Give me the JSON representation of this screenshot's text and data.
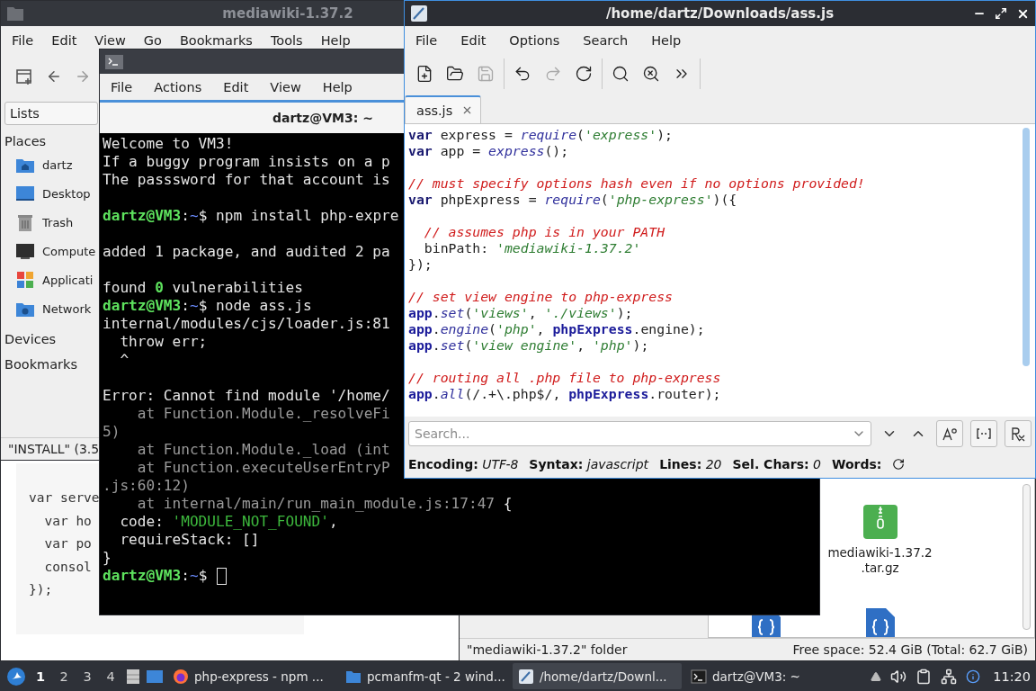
{
  "file_manager": {
    "title": "mediawiki-1.37.2",
    "menu": [
      "File",
      "Edit",
      "View",
      "Go",
      "Bookmarks",
      "Tools",
      "Help"
    ],
    "sidebar_mode": "Lists",
    "sections": [
      {
        "label": "Places",
        "items": [
          {
            "label": "dartz",
            "kind": "home"
          },
          {
            "label": "Desktop",
            "kind": "desktop"
          },
          {
            "label": "Trash",
            "kind": "trash"
          },
          {
            "label": "Compute",
            "kind": "computer"
          },
          {
            "label": "Applicati",
            "kind": "apps"
          },
          {
            "label": "Network",
            "kind": "network"
          }
        ]
      },
      {
        "label": "Devices"
      },
      {
        "label": "Bookmarks"
      }
    ],
    "status": "\"INSTALL\" (3.5"
  },
  "browser_page": {
    "code_lines": [
      "var serve",
      "  var ho",
      "  var po",
      "  consol",
      "});"
    ]
  },
  "terminal": {
    "menu": [
      "File",
      "Actions",
      "Edit",
      "View",
      "Help"
    ],
    "tab": "dartz@VM3: ~",
    "lines": [
      {
        "parts": [
          {
            "kind": "plain",
            "text": "Welcome to VM3!"
          }
        ]
      },
      {
        "parts": [
          {
            "kind": "plain",
            "text": "If a buggy program insists on a p"
          }
        ]
      },
      {
        "parts": [
          {
            "kind": "plain",
            "text": "The passsword for that account is"
          }
        ]
      },
      {
        "kind": "blank"
      },
      {
        "parts": [
          {
            "kind": "user",
            "text": "dartz@VM3"
          },
          {
            "kind": "plain",
            "text": ":"
          },
          {
            "kind": "path",
            "text": "~"
          },
          {
            "kind": "plain",
            "text": "$ npm install php-expre"
          }
        ]
      },
      {
        "kind": "blank"
      },
      {
        "parts": [
          {
            "kind": "plain",
            "text": "added 1 package, and audited 2 pa"
          }
        ]
      },
      {
        "kind": "blank"
      },
      {
        "parts": [
          {
            "kind": "plain",
            "text": "found "
          },
          {
            "kind": "num",
            "text": "0"
          },
          {
            "kind": "plain",
            "text": " vulnerabilities"
          }
        ]
      },
      {
        "parts": [
          {
            "kind": "user",
            "text": "dartz@VM3"
          },
          {
            "kind": "plain",
            "text": ":"
          },
          {
            "kind": "path",
            "text": "~"
          },
          {
            "kind": "plain",
            "text": "$ node ass.js"
          }
        ]
      },
      {
        "parts": [
          {
            "kind": "plain",
            "text": "internal/modules/cjs/loader.js:81"
          }
        ]
      },
      {
        "parts": [
          {
            "kind": "plain",
            "text": "  throw err;"
          }
        ]
      },
      {
        "parts": [
          {
            "kind": "plain",
            "text": "  ^"
          }
        ]
      },
      {
        "kind": "blank"
      },
      {
        "parts": [
          {
            "kind": "plain",
            "text": "Error: Cannot find module '/home/"
          }
        ]
      },
      {
        "parts": [
          {
            "kind": "dim",
            "text": "    at Function.Module._resolveFi"
          }
        ]
      },
      {
        "parts": [
          {
            "kind": "dim",
            "text": "5)"
          }
        ]
      },
      {
        "parts": [
          {
            "kind": "dim",
            "text": "    at Function.Module._load (int"
          }
        ]
      },
      {
        "parts": [
          {
            "kind": "dim",
            "text": "    at Function.executeUserEntryP"
          }
        ]
      },
      {
        "parts": [
          {
            "kind": "dim",
            "text": ".js:60:12)"
          }
        ]
      },
      {
        "parts": [
          {
            "kind": "dim",
            "text": "    at internal/main/run_main_module.js:17:47"
          },
          {
            "kind": "plain",
            "text": " {"
          }
        ]
      },
      {
        "parts": [
          {
            "kind": "plain",
            "text": "  code: "
          },
          {
            "kind": "str",
            "text": "'MODULE_NOT_FOUND'"
          },
          {
            "kind": "plain",
            "text": ","
          }
        ]
      },
      {
        "parts": [
          {
            "kind": "plain",
            "text": "  requireStack: []"
          }
        ]
      },
      {
        "parts": [
          {
            "kind": "plain",
            "text": "}"
          }
        ]
      },
      {
        "parts": [
          {
            "kind": "user",
            "text": "dartz@VM3"
          },
          {
            "kind": "plain",
            "text": ":"
          },
          {
            "kind": "path",
            "text": "~"
          },
          {
            "kind": "plain",
            "text": "$ "
          }
        ],
        "cursor": true
      }
    ]
  },
  "editor": {
    "title": "/home/dartz/Downloads/ass.js",
    "menu": [
      "File",
      "Edit",
      "Options",
      "Search",
      "Help"
    ],
    "toolbar": [
      [
        {
          "kind": "new",
          "disabled": false
        },
        {
          "kind": "open",
          "disabled": false
        },
        {
          "kind": "save",
          "disabled": true
        }
      ],
      [
        {
          "kind": "undo",
          "disabled": false
        },
        {
          "kind": "redo",
          "disabled": true
        },
        {
          "kind": "reload",
          "disabled": false
        }
      ],
      [
        {
          "kind": "find",
          "disabled": false
        },
        {
          "kind": "replace",
          "disabled": false
        },
        {
          "kind": "more",
          "disabled": false
        }
      ]
    ],
    "tab": "ass.js",
    "code": [
      {
        "parts": [
          {
            "kind": "kw",
            "text": "var"
          },
          {
            "kind": "plain",
            "text": " express = "
          },
          {
            "kind": "fn",
            "text": "require"
          },
          {
            "kind": "plain",
            "text": "("
          },
          {
            "kind": "str",
            "text": "'express'"
          },
          {
            "kind": "plain",
            "text": ");"
          }
        ]
      },
      {
        "parts": [
          {
            "kind": "kw",
            "text": "var"
          },
          {
            "kind": "plain",
            "text": " app = "
          },
          {
            "kind": "fn",
            "text": "express"
          },
          {
            "kind": "plain",
            "text": "();"
          }
        ]
      },
      {
        "kind": "blank"
      },
      {
        "parts": [
          {
            "kind": "cm",
            "text": "// must specify options hash even if no options provided!"
          }
        ]
      },
      {
        "parts": [
          {
            "kind": "kw",
            "text": "var"
          },
          {
            "kind": "plain",
            "text": " phpExpress = "
          },
          {
            "kind": "fn",
            "text": "require"
          },
          {
            "kind": "plain",
            "text": "("
          },
          {
            "kind": "str",
            "text": "'php-express'"
          },
          {
            "kind": "plain",
            "text": ")({"
          }
        ]
      },
      {
        "kind": "blank"
      },
      {
        "parts": [
          {
            "kind": "cm",
            "text": "  // assumes php is in your PATH"
          }
        ]
      },
      {
        "parts": [
          {
            "kind": "plain",
            "text": "  binPath: "
          },
          {
            "kind": "str",
            "text": "'mediawiki-1.37.2'"
          }
        ]
      },
      {
        "parts": [
          {
            "kind": "plain",
            "text": "});"
          }
        ]
      },
      {
        "kind": "blank"
      },
      {
        "parts": [
          {
            "kind": "cm",
            "text": "// set view engine to php-express"
          }
        ]
      },
      {
        "parts": [
          {
            "kind": "obj",
            "text": "app"
          },
          {
            "kind": "plain",
            "text": "."
          },
          {
            "kind": "fn",
            "text": "set"
          },
          {
            "kind": "plain",
            "text": "("
          },
          {
            "kind": "str",
            "text": "'views'"
          },
          {
            "kind": "plain",
            "text": ", "
          },
          {
            "kind": "str",
            "text": "'./views'"
          },
          {
            "kind": "plain",
            "text": ");"
          }
        ]
      },
      {
        "parts": [
          {
            "kind": "obj",
            "text": "app"
          },
          {
            "kind": "plain",
            "text": "."
          },
          {
            "kind": "fn",
            "text": "engine"
          },
          {
            "kind": "plain",
            "text": "("
          },
          {
            "kind": "str",
            "text": "'php'"
          },
          {
            "kind": "plain",
            "text": ", "
          },
          {
            "kind": "obj",
            "text": "phpExpress"
          },
          {
            "kind": "plain",
            "text": ".engine);"
          }
        ]
      },
      {
        "parts": [
          {
            "kind": "obj",
            "text": "app"
          },
          {
            "kind": "plain",
            "text": "."
          },
          {
            "kind": "fn",
            "text": "set"
          },
          {
            "kind": "plain",
            "text": "("
          },
          {
            "kind": "str",
            "text": "'view engine'"
          },
          {
            "kind": "plain",
            "text": ", "
          },
          {
            "kind": "str",
            "text": "'php'"
          },
          {
            "kind": "plain",
            "text": ");"
          }
        ]
      },
      {
        "kind": "blank"
      },
      {
        "parts": [
          {
            "kind": "cm",
            "text": "// routing all .php file to php-express"
          }
        ]
      },
      {
        "parts": [
          {
            "kind": "obj",
            "text": "app"
          },
          {
            "kind": "plain",
            "text": "."
          },
          {
            "kind": "fn",
            "text": "all"
          },
          {
            "kind": "plain",
            "text": "(/.+\\.php$/, "
          },
          {
            "kind": "obj",
            "text": "phpExpress"
          },
          {
            "kind": "plain",
            "text": ".router);"
          }
        ]
      }
    ],
    "search": {
      "placeholder": "Search..."
    },
    "status": [
      "**Encoding:** *UTF-8*",
      "**Syntax:** *javascript*",
      "**Lines:** *20*",
      "**Sel. Chars:** *0*",
      "**Words:**"
    ]
  },
  "file_manager_2": {
    "files": [
      {
        "kind": "archive",
        "name_lines": [
          "mediawiki-1.37.2",
          ".tar.gz"
        ]
      },
      {
        "kind": "script"
      },
      {
        "kind": "script"
      }
    ],
    "status_left": "\"mediawiki-1.37.2\" folder",
    "status_right": "Free space: 52.4 GiB (Total: 62.7 GiB)"
  },
  "taskbar": {
    "workspaces": [
      {
        "label": "1",
        "selected": true
      },
      {
        "label": "2",
        "selected": false
      },
      {
        "label": "3",
        "selected": false
      },
      {
        "label": "4",
        "selected": false
      }
    ],
    "tasks": [
      {
        "kind": "browser",
        "label": "php-express - npm ...",
        "selected": false
      },
      {
        "kind": "folder",
        "label": "pcmanfm-qt - 2 wind...",
        "selected": false
      },
      {
        "kind": "editor",
        "label": "/home/dartz/Downl...",
        "selected": true
      },
      {
        "kind": "terminal",
        "label": "dartz@VM3: ~",
        "selected": false
      }
    ],
    "clock": "11:20"
  }
}
